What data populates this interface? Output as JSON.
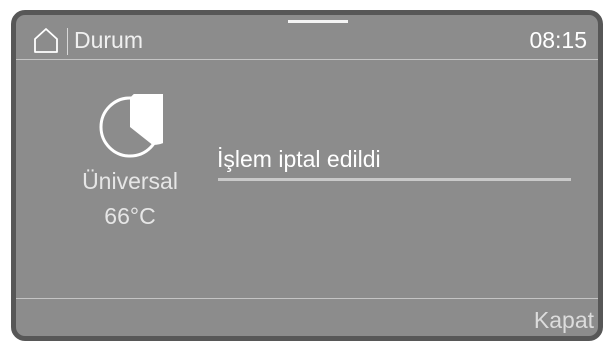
{
  "header": {
    "title": "Durum",
    "time": "08:15"
  },
  "program": {
    "icon": "half-circle-progress-icon",
    "name": "Üniversal",
    "temperature": "66°C"
  },
  "status": {
    "message": "İşlem iptal edildi"
  },
  "footer": {
    "close_label": "Kapat"
  },
  "colors": {
    "screen_background": "#8c8c8c",
    "bezel": "#575757",
    "text": "#ffffff"
  }
}
